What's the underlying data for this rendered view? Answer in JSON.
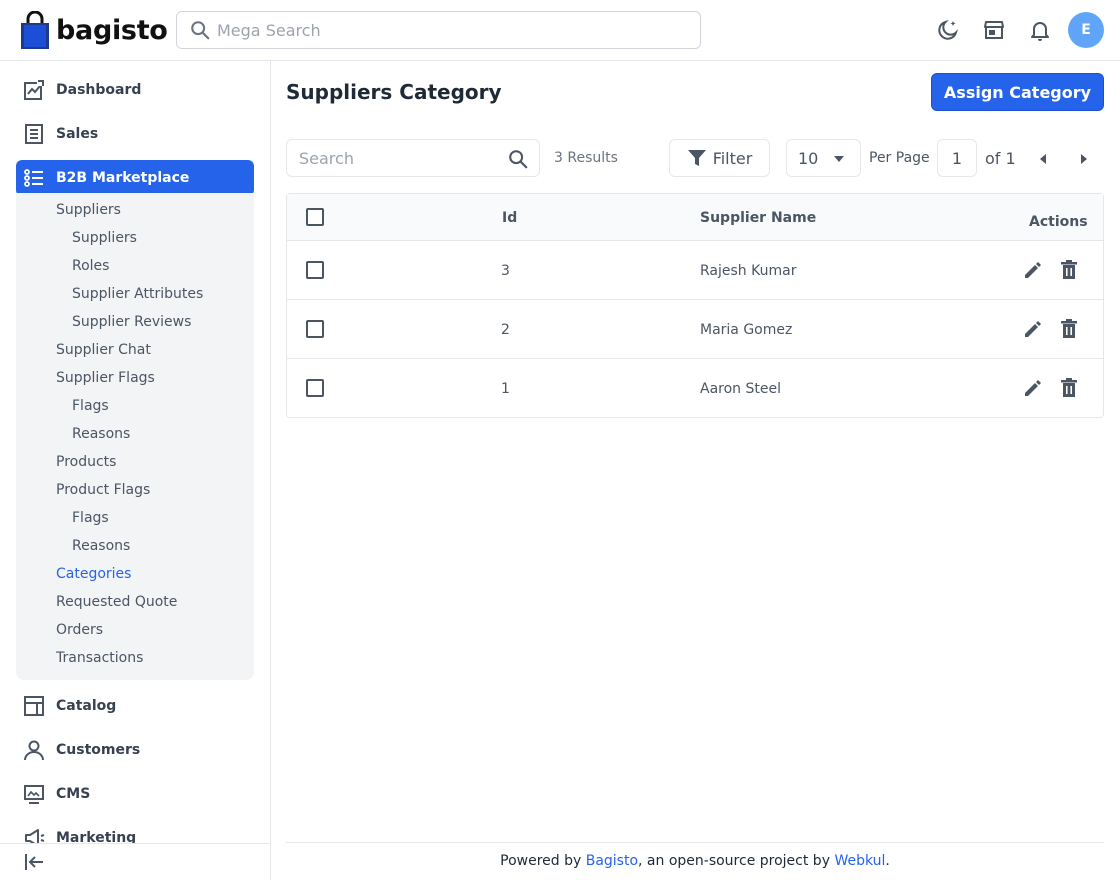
{
  "header": {
    "logo_text": "bagisto",
    "search_placeholder": "Mega Search",
    "avatar_initial": "E"
  },
  "sidebar": {
    "items": [
      {
        "label": "Dashboard",
        "icon": "dashboard-icon"
      },
      {
        "label": "Sales",
        "icon": "sales-icon"
      },
      {
        "label": "B2B Marketplace",
        "icon": "marketplace-icon",
        "active": true
      },
      {
        "label": "Catalog",
        "icon": "catalog-icon"
      },
      {
        "label": "Customers",
        "icon": "customers-icon"
      },
      {
        "label": "CMS",
        "icon": "cms-icon"
      },
      {
        "label": "Marketing",
        "icon": "marketing-icon"
      }
    ],
    "submenu": [
      {
        "label": "Suppliers",
        "level": 1
      },
      {
        "label": "Suppliers",
        "level": 2
      },
      {
        "label": "Roles",
        "level": 2
      },
      {
        "label": "Supplier Attributes",
        "level": 2
      },
      {
        "label": "Supplier Reviews",
        "level": 2
      },
      {
        "label": "Supplier Chat",
        "level": 1
      },
      {
        "label": "Supplier Flags",
        "level": 1
      },
      {
        "label": "Flags",
        "level": 2
      },
      {
        "label": "Reasons",
        "level": 2
      },
      {
        "label": "Products",
        "level": 1
      },
      {
        "label": "Product Flags",
        "level": 1
      },
      {
        "label": "Flags",
        "level": 2
      },
      {
        "label": "Reasons",
        "level": 2
      },
      {
        "label": "Categories",
        "level": 1,
        "active": true
      },
      {
        "label": "Requested Quote",
        "level": 1
      },
      {
        "label": "Orders",
        "level": 1
      },
      {
        "label": "Transactions",
        "level": 1
      }
    ]
  },
  "main": {
    "title": "Suppliers Category",
    "assign_button": "Assign Category",
    "search_placeholder": "Search",
    "results": "3 Results",
    "filter_label": "Filter",
    "per_page_value": "10",
    "per_page_label": "Per Page",
    "page_value": "1",
    "of_label": "of 1"
  },
  "table": {
    "columns": {
      "id": "Id",
      "supplier_name": "Supplier Name",
      "actions": "Actions"
    },
    "rows": [
      {
        "id": "3",
        "supplier_name": "Rajesh Kumar"
      },
      {
        "id": "2",
        "supplier_name": "Maria Gomez"
      },
      {
        "id": "1",
        "supplier_name": "Aaron Steel"
      }
    ]
  },
  "footer": {
    "prefix": "Powered by ",
    "link1": "Bagisto",
    "middle": ", an open-source project by ",
    "link2": "Webkul",
    "suffix": "."
  },
  "colors": {
    "accent": "#2563eb",
    "avatar": "#60a5fa"
  }
}
